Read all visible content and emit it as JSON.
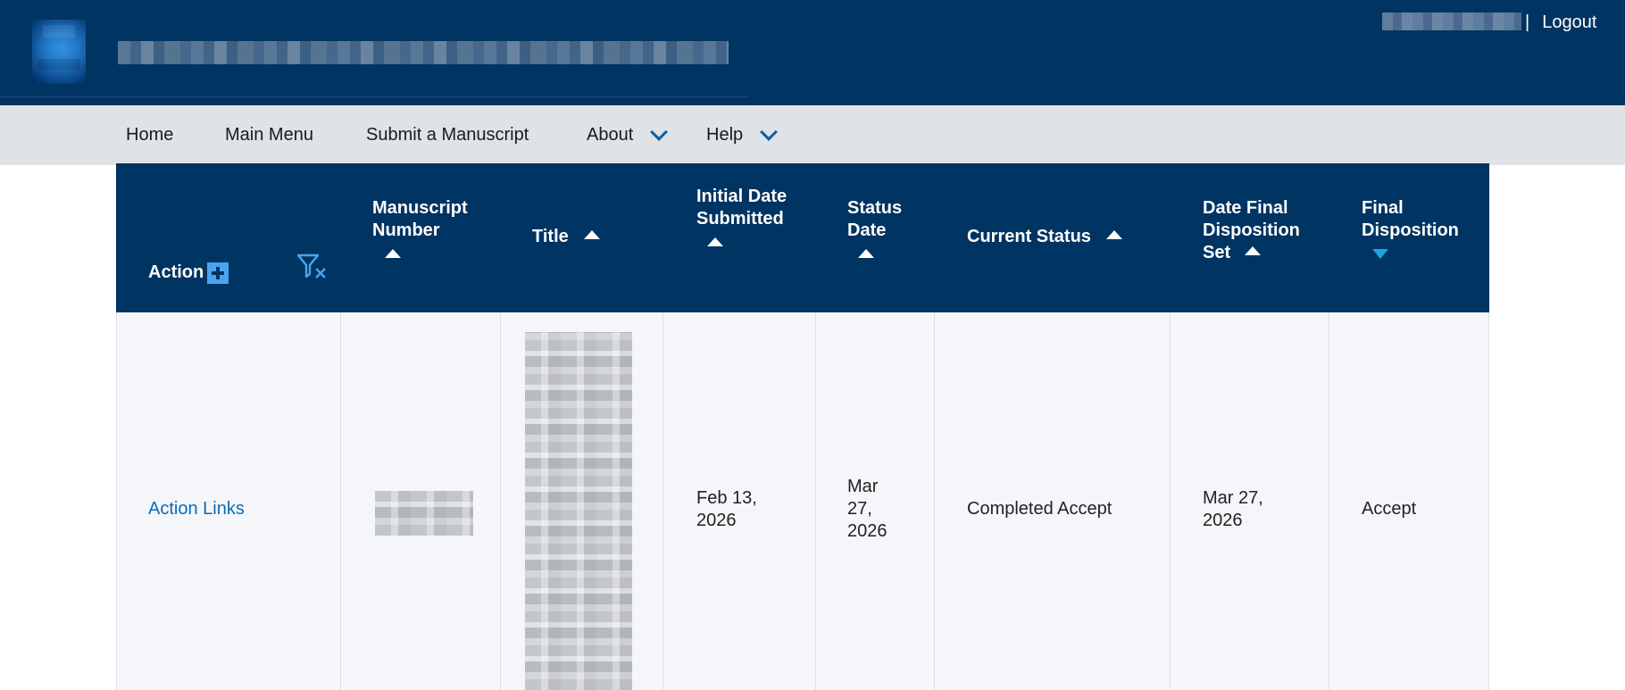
{
  "header": {
    "logo_icon": "journal-logo",
    "user_separator": "|",
    "logout_label": "Logout"
  },
  "nav": {
    "items": [
      {
        "label": "Home"
      },
      {
        "label": "Main Menu"
      },
      {
        "label": "Submit a Manuscript"
      },
      {
        "label": "About",
        "icon": "chevron-down-icon"
      },
      {
        "label": "Help",
        "icon": "chevron-down-icon"
      }
    ]
  },
  "table": {
    "columns": [
      {
        "key": "action",
        "label": "Action",
        "icon": "plus-icon"
      },
      {
        "key": "filter",
        "icon": "clear-filter-icon"
      },
      {
        "key": "manuscript_number",
        "label": "Manuscript Number",
        "sort": "asc"
      },
      {
        "key": "title",
        "label": "Title",
        "sort": "asc"
      },
      {
        "key": "initial_date_submitted",
        "label": "Initial Date Submitted",
        "sort": "asc"
      },
      {
        "key": "status_date",
        "label": "Status Date",
        "sort": "asc"
      },
      {
        "key": "current_status",
        "label": "Current Status",
        "sort": "asc"
      },
      {
        "key": "date_final_disposition_set",
        "label": "Date Final Disposition Set",
        "sort": "asc"
      },
      {
        "key": "final_disposition",
        "label": "Final Disposition",
        "sort": "desc-active"
      }
    ],
    "rows": [
      {
        "action": "Action Links",
        "initial_date_submitted": [
          "Feb 13,",
          "2026"
        ],
        "status_date": [
          "Mar",
          "27,",
          "2026"
        ],
        "current_status": "Completed Accept",
        "date_final_disposition_set": [
          "Mar 27,",
          "2026"
        ],
        "final_disposition": "Accept"
      }
    ]
  },
  "colors": {
    "header_bg": "#003462",
    "nav_bg": "#dfe2e6",
    "row_bg": "#f5f6fa",
    "link": "#0b6cb5",
    "accent": "#4aa3ef",
    "sort_active": "#19a3e6"
  }
}
